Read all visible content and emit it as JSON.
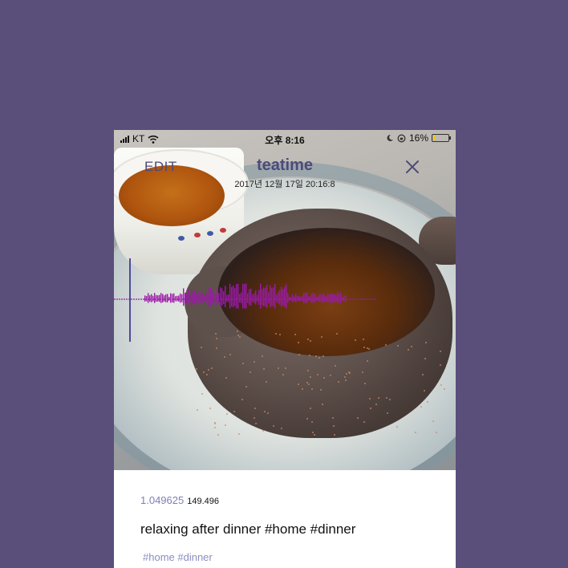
{
  "status_bar": {
    "carrier": "KT",
    "time": "오후 8:16",
    "battery_percent": "16%",
    "battery_level": 0.16,
    "battery_color": "#f2c318"
  },
  "header": {
    "edit_label": "EDIT",
    "title": "teatime",
    "datetime": "2017년 12월 17일 20:16:8",
    "accent_color": "#4e4a7a",
    "close_icon": "close-icon"
  },
  "waveform": {
    "color": "#9a1aa6",
    "cursor_color": "#4e4a9a"
  },
  "details": {
    "latitude": "1.049625",
    "longitude": "149.496",
    "caption": "relaxing after dinner #home #dinner",
    "tags": "#home #dinner"
  },
  "colors": {
    "background": "#5a4e7a",
    "tag_color": "#8a8ec0"
  }
}
